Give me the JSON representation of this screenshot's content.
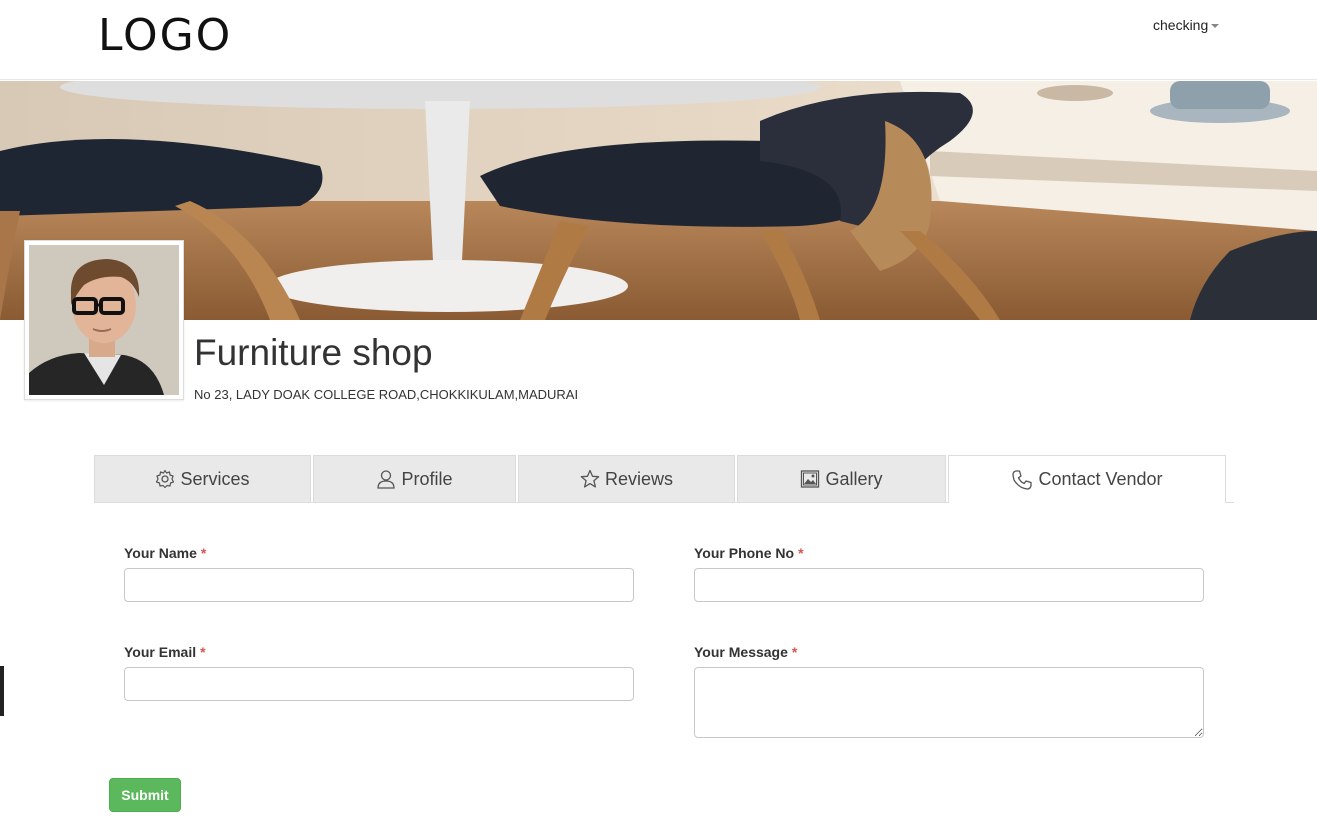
{
  "header": {
    "logo_text": "LOGO",
    "user_menu_label": "checking"
  },
  "vendor": {
    "name": "Furniture shop",
    "address": "No 23, LADY DOAK COLLEGE ROAD,CHOKKIKULAM,MADURAI"
  },
  "tabs": [
    {
      "label": "Services",
      "icon": "gear-icon",
      "active": false
    },
    {
      "label": "Profile",
      "icon": "user-icon",
      "active": false
    },
    {
      "label": "Reviews",
      "icon": "star-icon",
      "active": false
    },
    {
      "label": "Gallery",
      "icon": "image-icon",
      "active": false
    },
    {
      "label": "Contact Vendor",
      "icon": "phone-icon",
      "active": true
    }
  ],
  "form": {
    "name_label": "Your Name",
    "phone_label": "Your Phone No",
    "email_label": "Your Email",
    "message_label": "Your Message",
    "required_marker": "*",
    "name_value": "",
    "phone_value": "",
    "email_value": "",
    "message_value": "",
    "submit_label": "Submit"
  },
  "colors": {
    "submit_bg": "#5cb85c",
    "required": "#d9534f",
    "tab_inactive_bg": "#e9e9e9"
  }
}
